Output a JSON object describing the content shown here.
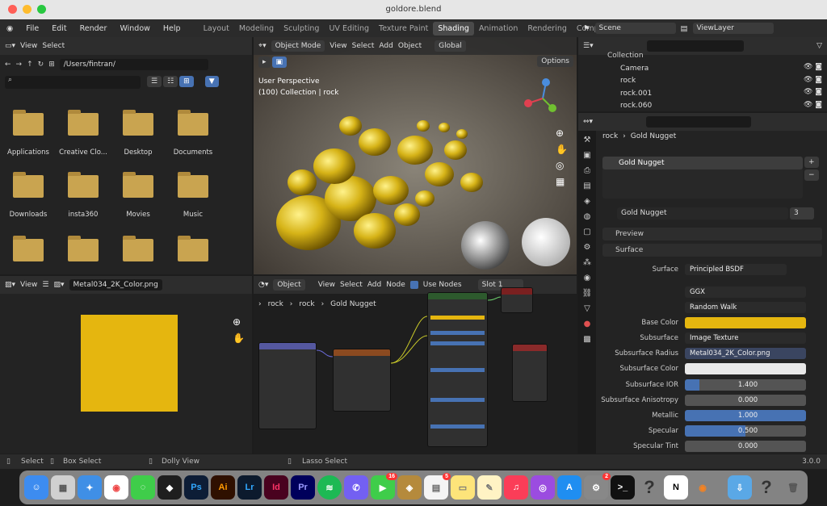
{
  "window": {
    "title": "goldore.blend"
  },
  "menu": [
    "File",
    "Edit",
    "Render",
    "Window",
    "Help"
  ],
  "workspaces": [
    "Layout",
    "Modeling",
    "Sculpting",
    "UV Editing",
    "Texture Paint",
    "Shading",
    "Animation",
    "Rendering",
    "Compositing"
  ],
  "scene": "Scene",
  "view_layer": "ViewLayer",
  "filebrowser": {
    "view": "View",
    "select": "Select",
    "path": "/Users/fintran/",
    "folders": [
      "Applications",
      "Creative Clo...",
      "Desktop",
      "Documents",
      "Downloads",
      "insta360",
      "Movies",
      "Music"
    ]
  },
  "viewport": {
    "mode": "Object Mode",
    "menus": [
      "View",
      "Select",
      "Add",
      "Object"
    ],
    "transform": "Global",
    "options": "Options",
    "line1": "User Perspective",
    "line2": "(100) Collection | rock"
  },
  "outliner": {
    "items": [
      "Collection",
      "Camera",
      "rock",
      "rock.001",
      "rock.060"
    ]
  },
  "image_editor": {
    "view": "View",
    "image": "Metal034_2K_Color.png"
  },
  "node_editor": {
    "editor_type": "Object",
    "menus": [
      "View",
      "Select",
      "Add",
      "Node"
    ],
    "use_nodes": "Use Nodes",
    "slot": "Slot 1",
    "breadcrumb": [
      "rock",
      "rock",
      "Gold Nugget"
    ]
  },
  "properties": {
    "breadcrumb": [
      "rock",
      "Gold Nugget"
    ],
    "material_slot": "Gold Nugget",
    "material_name": "Gold Nugget",
    "users": "3",
    "preview": "Preview",
    "surface_panel": "Surface",
    "rows": [
      {
        "label": "Surface",
        "value": "Principled BSDF"
      },
      {
        "label": "",
        "value": "GGX"
      },
      {
        "label": "",
        "value": "Random Walk"
      },
      {
        "label": "Base Color",
        "value": ""
      },
      {
        "label": "Subsurface",
        "value": "Image Texture"
      },
      {
        "label": "Subsurface Radius",
        "value": "Metal034_2K_Color.png"
      },
      {
        "label": "Subsurface Color",
        "value": ""
      },
      {
        "label": "Subsurface IOR",
        "value": "1.400"
      },
      {
        "label": "Subsurface Anisotropy",
        "value": "0.000"
      },
      {
        "label": "Metallic",
        "value": "1.000"
      },
      {
        "label": "Specular",
        "value": "0.500"
      },
      {
        "label": "Specular Tint",
        "value": "0.000"
      }
    ]
  },
  "status": {
    "select": "Select",
    "box_select": "Box Select",
    "dolly": "Dolly View",
    "lasso": "Lasso Select",
    "version": "3.0.0"
  },
  "dock": [
    "Finder",
    "Launchpad",
    "Safari",
    "Chrome",
    "Messages",
    "Figma",
    "Ps",
    "Ai",
    "Lr",
    "Id",
    "Pr",
    "Spotify",
    "Viber",
    "FaceTime",
    "Notes",
    "Music",
    "Podcasts",
    "App Store",
    "Settings",
    "Terminal",
    "Notion",
    "Blender"
  ],
  "badges": {
    "facetime": "16",
    "mail": "5",
    "settings": "2"
  },
  "colors": {
    "gold": "#e5b60f",
    "accent": "#4772b3"
  }
}
